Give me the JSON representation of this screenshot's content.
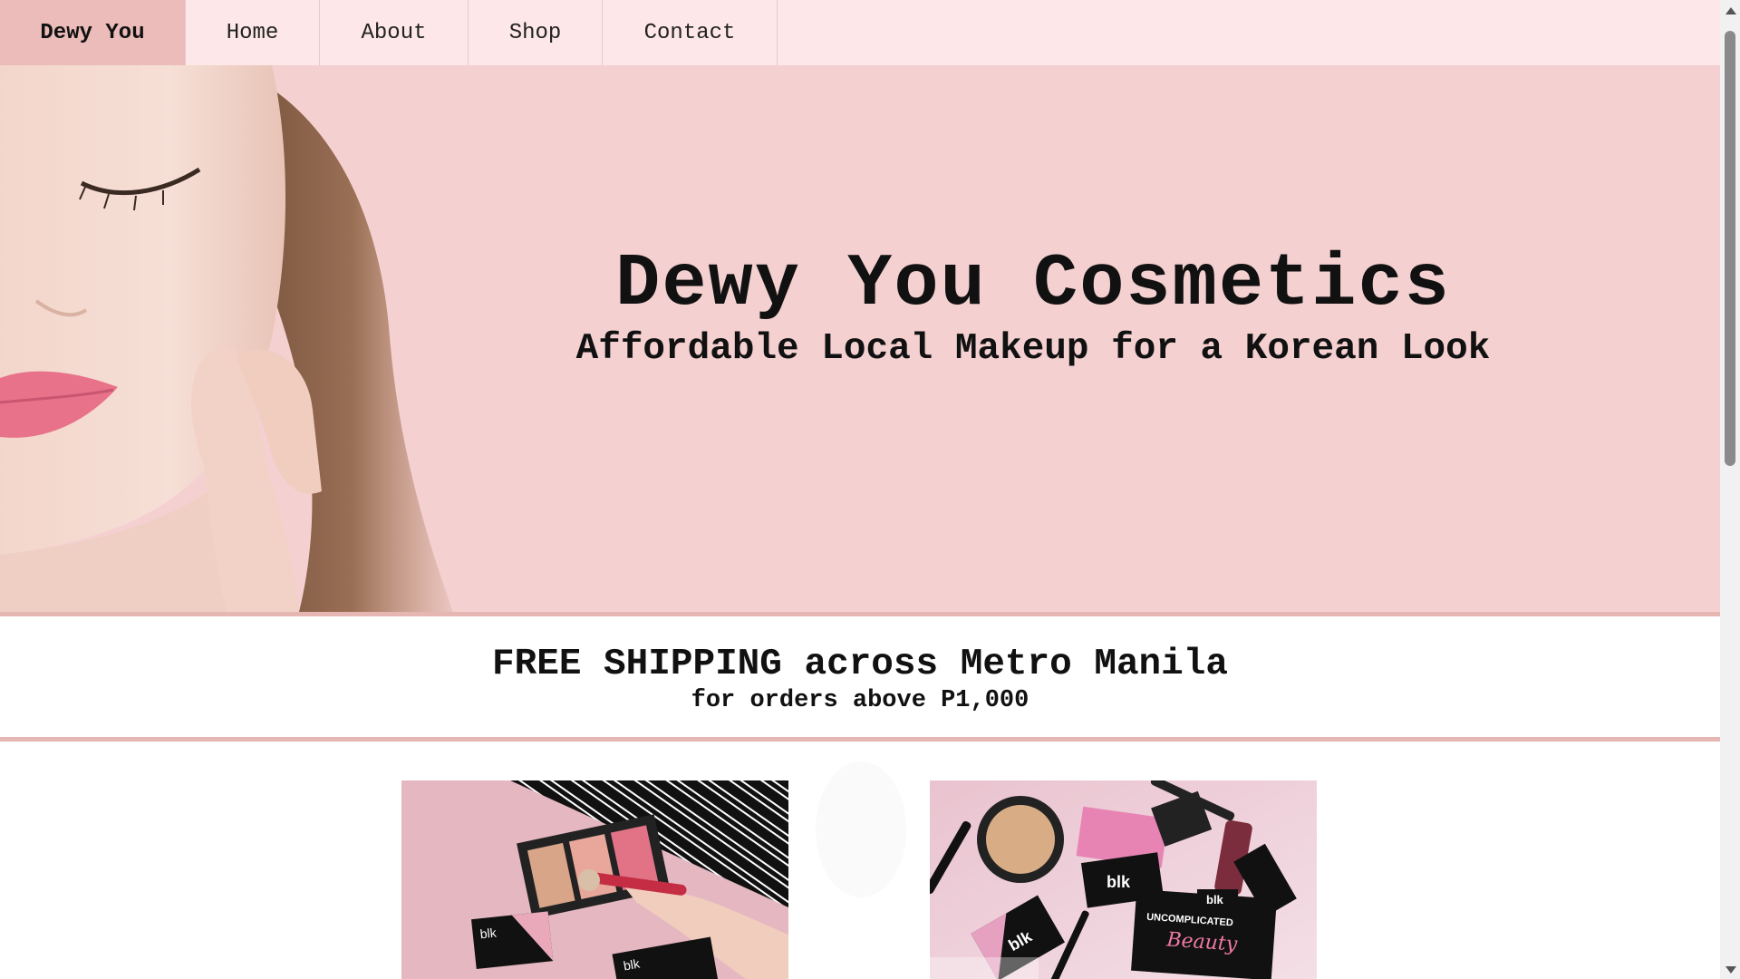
{
  "nav": {
    "brand": "Dewy You",
    "items": [
      {
        "label": "Home"
      },
      {
        "label": "About"
      },
      {
        "label": "Shop"
      },
      {
        "label": "Contact"
      }
    ]
  },
  "hero": {
    "title": "Dewy You Cosmetics",
    "subtitle": "Affordable Local Makeup for a Korean Look",
    "image": "woman-face-closed-eyes-photo"
  },
  "shipping": {
    "title": "FREE SHIPPING across Metro Manila",
    "subtitle": "for orders above P1,000"
  },
  "products": {
    "images": [
      {
        "name": "blk-palette-brush-photo",
        "brand_text": "blk"
      },
      {
        "name": "blk-makeup-flatlay-photo",
        "brand_text": "blk",
        "box_text": "UNCOMPLICATED",
        "box_script": "Beauty"
      }
    ]
  },
  "colors": {
    "nav_bg": "#fde7e8",
    "brand_bg": "#ebbcb9",
    "hero_bg": "#f4d0d0",
    "accent_border": "#e6b6b3"
  }
}
